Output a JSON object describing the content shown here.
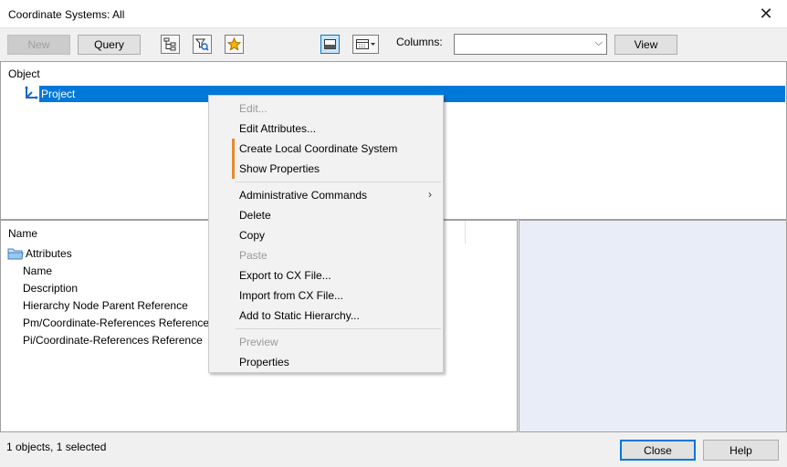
{
  "window": {
    "title": "Coordinate Systems: All"
  },
  "toolbar": {
    "new_label": "New",
    "query_label": "Query",
    "columns_label": "Columns:",
    "columns_value": "",
    "view_label": "View"
  },
  "tree": {
    "header": "Object",
    "selected_item": "Project"
  },
  "properties": {
    "header": "Name",
    "group": "Attributes",
    "items": [
      "Name",
      "Description",
      "Hierarchy Node Parent Reference",
      "Pm/Coordinate-References Reference",
      "Pi/Coordinate-References Reference"
    ]
  },
  "context_menu": {
    "edit": "Edit...",
    "edit_attributes": "Edit Attributes...",
    "create_local": "Create Local Coordinate System",
    "show_properties": "Show Properties",
    "admin_commands": "Administrative Commands",
    "delete": "Delete",
    "copy": "Copy",
    "paste": "Paste",
    "export_cx": "Export to CX File...",
    "import_cx": "Import from CX File...",
    "add_static": "Add to Static Hierarchy...",
    "preview": "Preview",
    "properties": "Properties"
  },
  "status": {
    "text": "1 objects, 1 selected",
    "close_label": "Close",
    "help_label": "Help"
  },
  "colors": {
    "selection": "#0078d7",
    "accent": "#e7892f",
    "preview_pane": "#e8edf7"
  }
}
